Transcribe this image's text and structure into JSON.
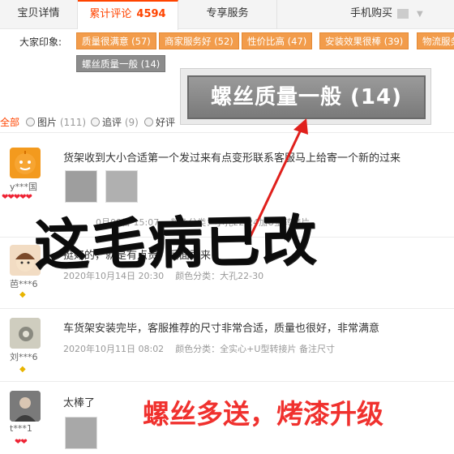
{
  "tabs": {
    "detail": "宝贝详情",
    "reviews": "累计评论",
    "reviews_count": "4594",
    "service": "专享服务",
    "mobile": "手机购买"
  },
  "impressions": {
    "label": "大家印象:",
    "tags": [
      "质量很满意 (57)",
      "商家服务好 (52)",
      "性价比高 (47)",
      "安装效果很棒 (39)",
      "物流服务",
      "螺丝质量一般 (14)"
    ]
  },
  "zoom_callout": "螺丝质量一般 (14)",
  "filters": {
    "all": "全部",
    "images": "图片",
    "images_count": "(111)",
    "followup": "追评",
    "followup_count": "(9)",
    "good": "好评"
  },
  "reviews": [
    {
      "user": "y***国",
      "text": "货架收到大小合适第一个发过来有点变形联系客服马上给寄一个新的过来",
      "date": "0月09日 15:07",
      "spec": "颜色分类：小孔22-24加U型转接片"
    },
    {
      "user": "芭***6",
      "text": "挺好的，就是有点贵，后面再来",
      "date": "2020年10月14日 20:30",
      "spec": "颜色分类：大孔22-30"
    },
    {
      "user": "刘***6",
      "text": "车货架安装完毕，客服推荐的尺寸非常合适，质量也很好，非常满意",
      "date": "2020年10月11日 08:02",
      "spec": "颜色分类：全实心+U型转接片 备注尺寸"
    },
    {
      "user": "t***1",
      "text": "太棒了",
      "date": "",
      "spec": ""
    }
  ],
  "overlay": {
    "ink_text": "这毛病已改",
    "red_text": "螺丝多送，烤漆升级"
  },
  "colors": {
    "accent": "#ff4400",
    "tag_orange": "#f29c4b",
    "tag_grey": "#8c8c8c",
    "overlay_red": "#f0312e"
  }
}
